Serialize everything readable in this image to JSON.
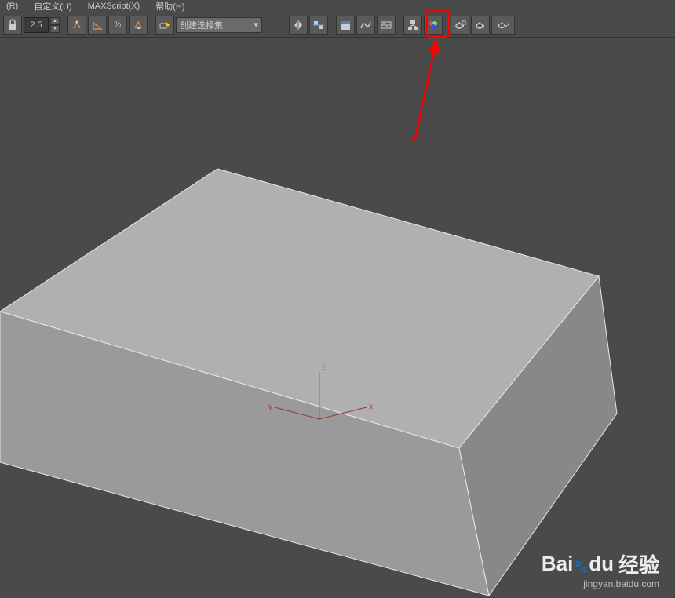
{
  "menubar": {
    "items": [
      "(R)",
      "自定义(U)",
      "MAXScript(X)",
      "帮助(H)"
    ]
  },
  "toolbar": {
    "spinner_value": "2.5",
    "dropdown_value": "创建选择集",
    "dropdown_arrow": "▾"
  },
  "watermark": {
    "brand_a": "Bai",
    "brand_b": "du",
    "brand_suffix": "经验",
    "url": "jingyan.baidu.com"
  },
  "axis": {
    "x": "x",
    "y": "y",
    "z": "z"
  },
  "icons": {
    "magnet": "🧲",
    "angle": "∠",
    "percent": "%",
    "edit": "✎",
    "layer": "▦",
    "graph": "⫽",
    "curve": "〰",
    "schematic": "⊞",
    "material": "◉",
    "render": "☕"
  }
}
